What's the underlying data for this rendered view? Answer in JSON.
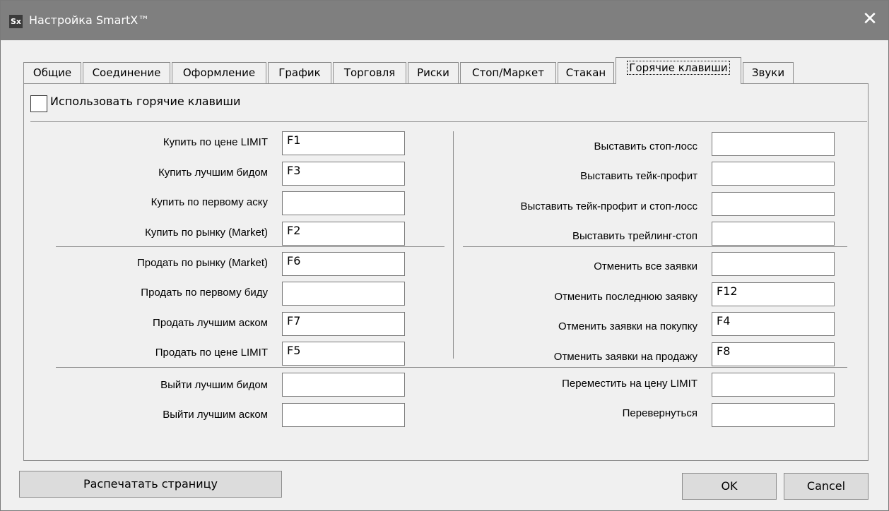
{
  "window": {
    "app_icon_text": "Sx",
    "title": "Настройка SmartX™",
    "close_glyph": "✕"
  },
  "tabs": [
    {
      "label": "Общие"
    },
    {
      "label": "Соединение"
    },
    {
      "label": "Оформление"
    },
    {
      "label": "График"
    },
    {
      "label": "Торговля"
    },
    {
      "label": "Риски"
    },
    {
      "label": "Стоп/Маркет"
    },
    {
      "label": "Стакан"
    },
    {
      "label": "Горячие клавиши",
      "active": true
    },
    {
      "label": "Звуки"
    }
  ],
  "hotkeys": {
    "enable_label": "Использовать горячие клавиши",
    "enable_checked": false,
    "left": [
      {
        "label": "Купить по цене LIMIT",
        "value": "F1"
      },
      {
        "label": "Купить лучшим бидом",
        "value": "F3"
      },
      {
        "label": "Купить по первому аску",
        "value": ""
      },
      {
        "label": "Купить по рынку (Market)",
        "value": "F2"
      },
      {
        "label": "Продать по рынку (Market)",
        "value": "F6"
      },
      {
        "label": "Продать по первому биду",
        "value": ""
      },
      {
        "label": "Продать лучшим аском",
        "value": "F7"
      },
      {
        "label": "Продать по цене LIMIT",
        "value": "F5"
      },
      {
        "label": "Выйти лучшим бидом",
        "value": ""
      },
      {
        "label": "Выйти лучшим аском",
        "value": ""
      }
    ],
    "right": [
      {
        "label": "Выставить стоп-лосс",
        "value": ""
      },
      {
        "label": "Выставить тейк-профит",
        "value": ""
      },
      {
        "label": "Выставить тейк-профит и стоп-лосс",
        "value": ""
      },
      {
        "label": "Выставить трейлинг-стоп",
        "value": ""
      },
      {
        "label": "Отменить все заявки",
        "value": ""
      },
      {
        "label": "Отменить последнюю заявку",
        "value": "F12"
      },
      {
        "label": "Отменить заявки на покупку",
        "value": "F4"
      },
      {
        "label": "Отменить заявки на продажу",
        "value": "F8"
      },
      {
        "label": "Переместить на цену LIMIT",
        "value": ""
      },
      {
        "label": "Перевернуться",
        "value": ""
      }
    ]
  },
  "buttons": {
    "print": "Распечатать страницу",
    "ok": "OK",
    "cancel": "Cancel"
  }
}
